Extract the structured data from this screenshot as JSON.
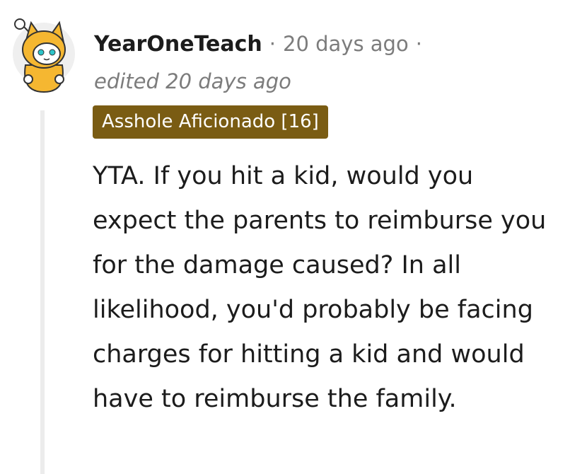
{
  "comment": {
    "author": "YearOneTeach",
    "separator": "·",
    "timestamp": "20 days ago",
    "edited": "edited 20 days ago",
    "flair": "Asshole Aficionado [16]",
    "body": "YTA. If you hit a kid, would you expect the parents to reimburse you for the damage caused? In all likelihood, you'd probably be facing charges for hitting a kid and would have to reimburse the family.",
    "avatar_icon": "snoo-shiba-costume-avatar"
  },
  "colors": {
    "flair_background": "#7a5c13",
    "flair_text": "#ffffff",
    "meta_text": "#7c7c7c",
    "body_text": "#1c1c1c",
    "avatar_costume": "#f5b731",
    "thread_line": "#ececec"
  }
}
